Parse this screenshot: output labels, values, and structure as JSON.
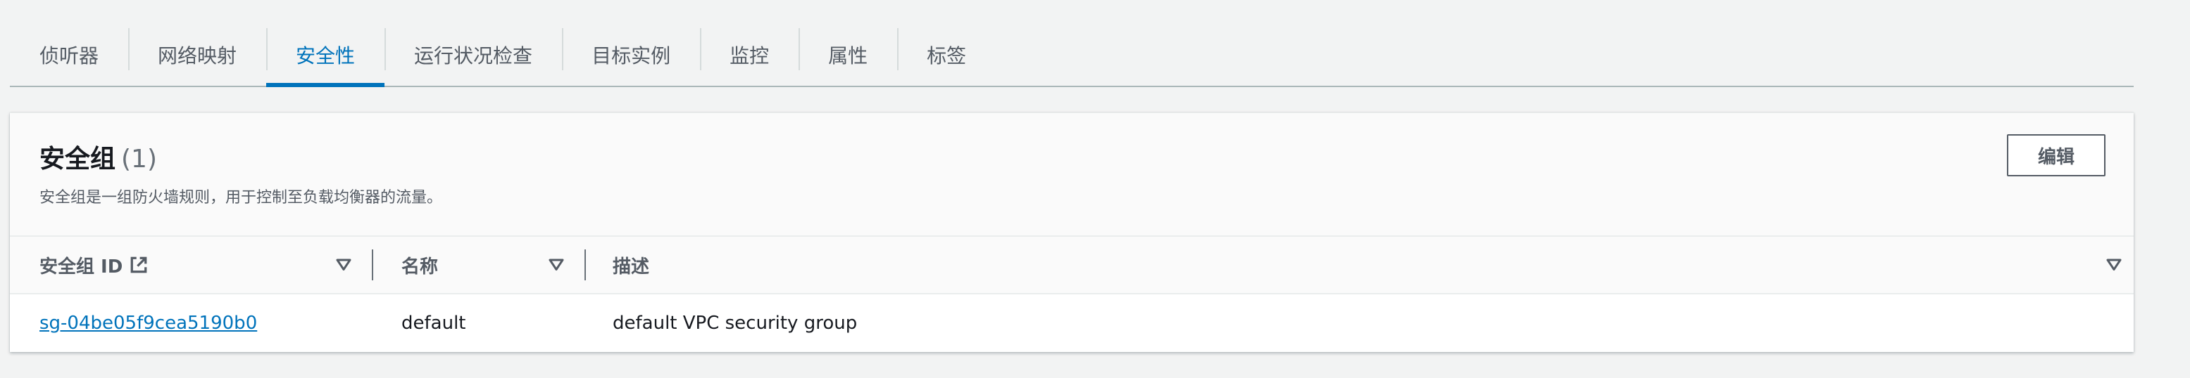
{
  "tabs": [
    {
      "label": "侦听器",
      "active": false
    },
    {
      "label": "网络映射",
      "active": false
    },
    {
      "label": "安全性",
      "active": true
    },
    {
      "label": "运行状况检查",
      "active": false
    },
    {
      "label": "目标实例",
      "active": false
    },
    {
      "label": "监控",
      "active": false
    },
    {
      "label": "属性",
      "active": false
    },
    {
      "label": "标签",
      "active": false
    }
  ],
  "panel": {
    "title": "安全组",
    "count": "(1)",
    "description": "安全组是一组防火墙规则，用于控制至负载均衡器的流量。",
    "edit_label": "编辑"
  },
  "table": {
    "columns": [
      {
        "label": "安全组 ID",
        "icon": "external-link-icon"
      },
      {
        "label": "名称"
      },
      {
        "label": "描述"
      }
    ],
    "rows": [
      {
        "id": "sg-04be05f9cea5190b0",
        "name": "default",
        "description": "default VPC security group"
      }
    ]
  },
  "colors": {
    "accent": "#0073bb",
    "text": "#16191f",
    "muted": "#545b64",
    "background": "#f2f3f3"
  }
}
